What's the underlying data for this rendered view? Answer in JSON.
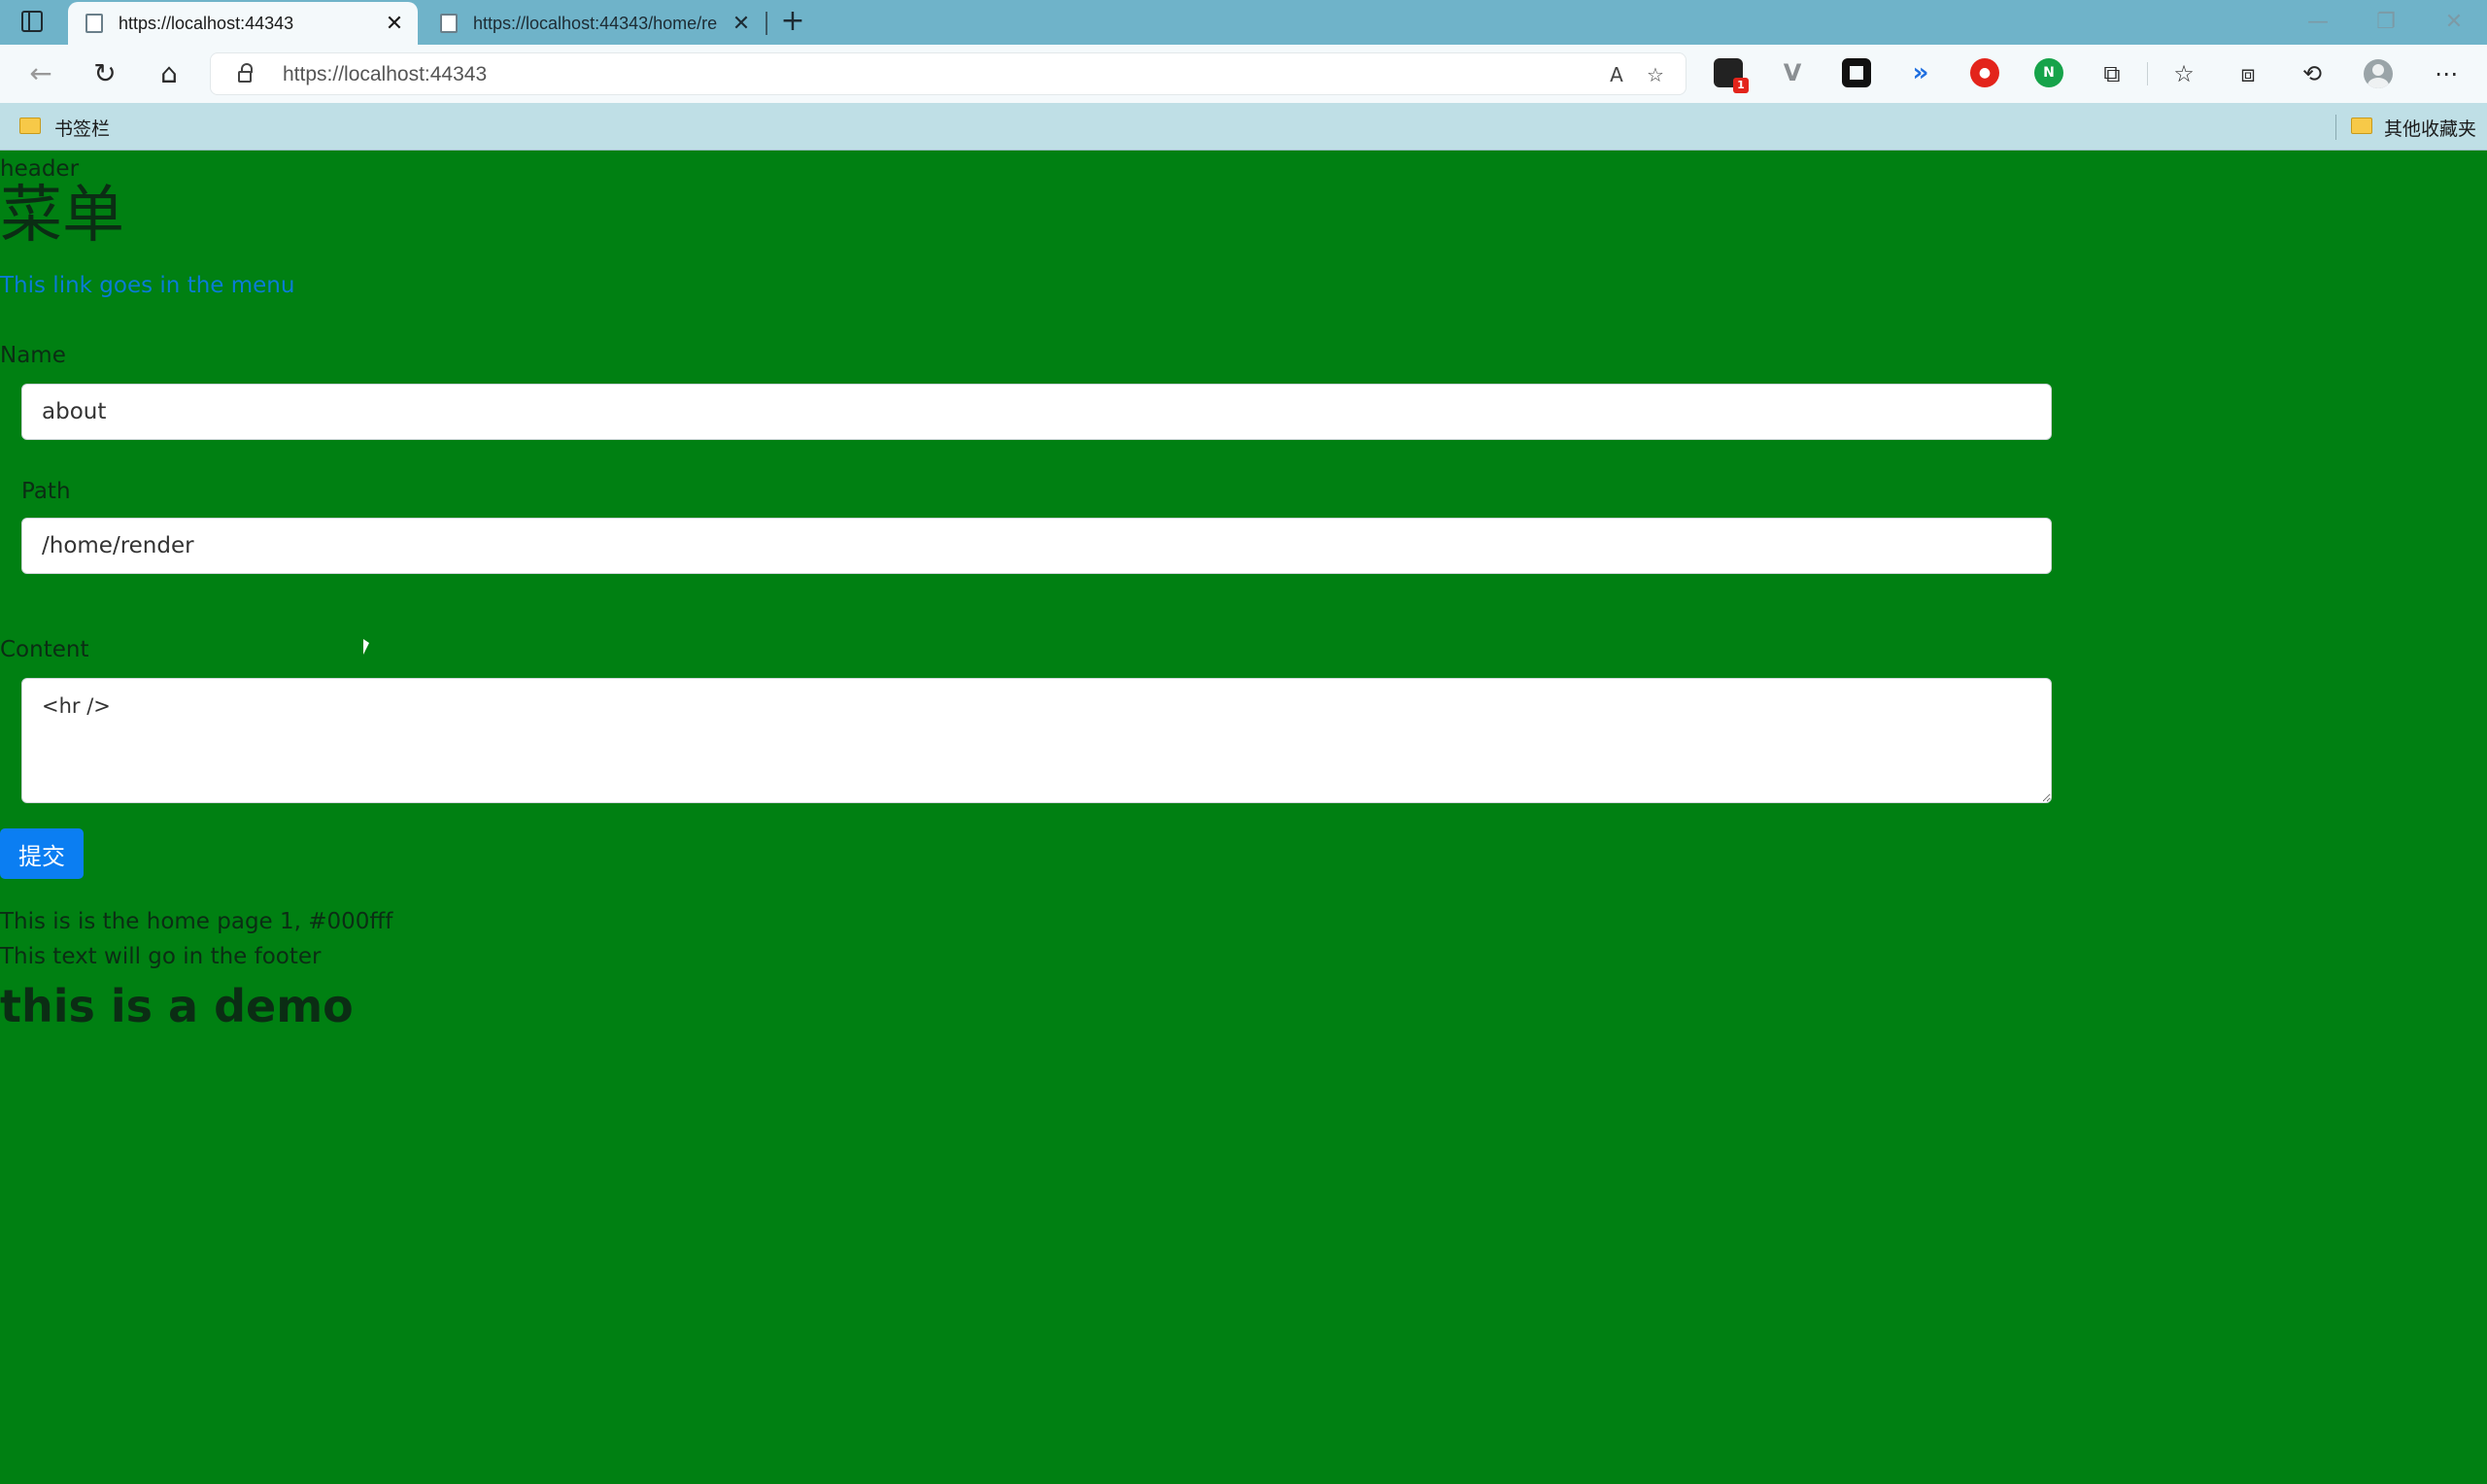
{
  "browser": {
    "tabs": [
      {
        "title": "https://localhost:44343",
        "close": "✕"
      },
      {
        "title": "https://localhost:44343/home/re",
        "close": "✕"
      }
    ],
    "new_tab": "+",
    "window_controls": {
      "minimize": "—",
      "restore": "❐",
      "close": "✕"
    },
    "address": {
      "url": "https://localhost:44343"
    },
    "nav": {
      "back": "←",
      "refresh": "↻",
      "home": "⌂"
    },
    "address_icons": {
      "read_aloud": "A",
      "favorite": "☆"
    },
    "extensions": [
      {
        "name": "ext-1-icon",
        "badge": "1",
        "color": "#222222"
      },
      {
        "name": "ext-2-icon",
        "color": "#8a8f93"
      },
      {
        "name": "ext-3-icon",
        "color": "#111111"
      },
      {
        "name": "ext-4-icon",
        "color": "#1f6fe0"
      },
      {
        "name": "ext-5-icon",
        "color": "#e3241b"
      },
      {
        "name": "ext-6-icon",
        "color": "#16a34a"
      }
    ],
    "toolbar_icons": {
      "extensions": "⧉",
      "favorites": "☆",
      "collections": "⧈",
      "history": "⟲",
      "more": "⋯"
    },
    "bookmarks": {
      "left": "书签栏",
      "right": "其他收藏夹"
    }
  },
  "page": {
    "header": "header",
    "menu_title": "菜单",
    "menu_link": "This link goes in the menu",
    "form": {
      "name_label": "Name",
      "name_value": "about",
      "path_label": "Path",
      "path_value": "/home/render",
      "content_label": "Content",
      "content_value": "<hr />",
      "submit_label": "提交"
    },
    "home_text": "This is is the home page 1, #000fff",
    "footer_text": "This text will go in the footer",
    "demo_heading": "this is a demo"
  },
  "colors": {
    "page_background": "#008012",
    "link": "#0a7cd6",
    "button": "#0b7ef2",
    "tabstrip": "#6fb3c9",
    "bookmarks_bar": "#bfdfe6"
  }
}
